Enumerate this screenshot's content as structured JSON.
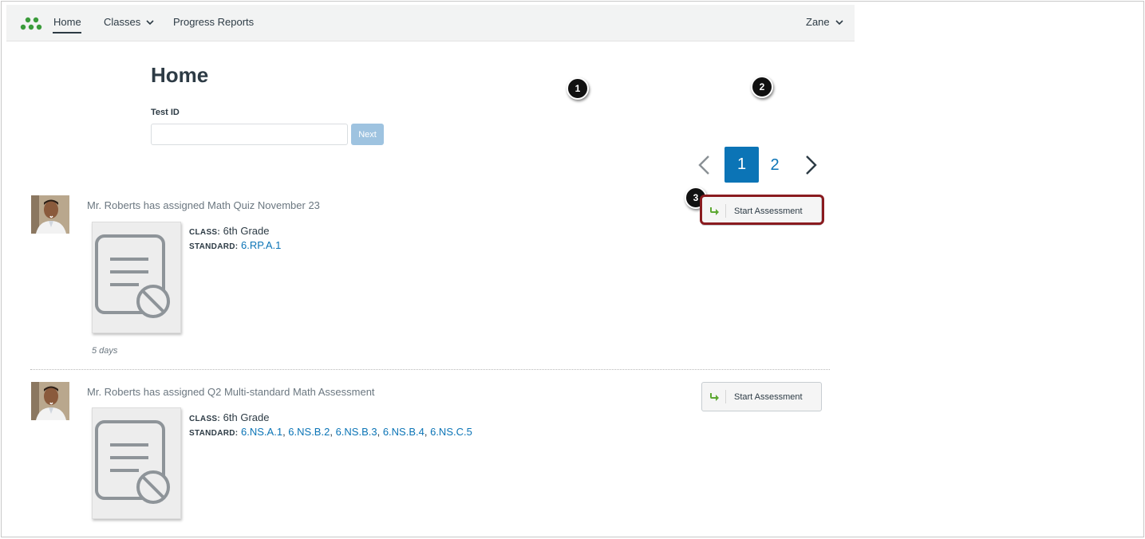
{
  "nav": {
    "logo_icon": "canvas-dots-logo-icon",
    "home": "Home",
    "classes": "Classes",
    "progress_reports": "Progress Reports",
    "user": "Zane"
  },
  "page": {
    "title": "Home",
    "test_id_label": "Test ID",
    "test_id_value": "",
    "next_button": "Next"
  },
  "markers": [
    "1",
    "2",
    "3"
  ],
  "pagination": {
    "current": "1",
    "other": "2"
  },
  "assignments": [
    {
      "text": "Mr. Roberts has assigned Math Quiz November 23",
      "class_label": "CLASS:",
      "class_value": "6th Grade",
      "standard_label": "STANDARD:",
      "standards": [
        "6.RP.A.1"
      ],
      "time": "5 days",
      "button": "Start Assessment"
    },
    {
      "text": "Mr. Roberts has assigned Q2 Multi-standard Math Assessment",
      "class_label": "CLASS:",
      "class_value": "6th Grade",
      "standard_label": "STANDARD:",
      "standards": [
        "6.NS.A.1",
        "6.NS.B.2",
        "6.NS.B.3",
        "6.NS.B.4",
        "6.NS.C.5"
      ],
      "button": "Start Assessment"
    }
  ],
  "colors": {
    "brand_green": "#3a9b3a",
    "link_blue": "#0b74b6",
    "highlight_red": "#8a1b1f"
  }
}
